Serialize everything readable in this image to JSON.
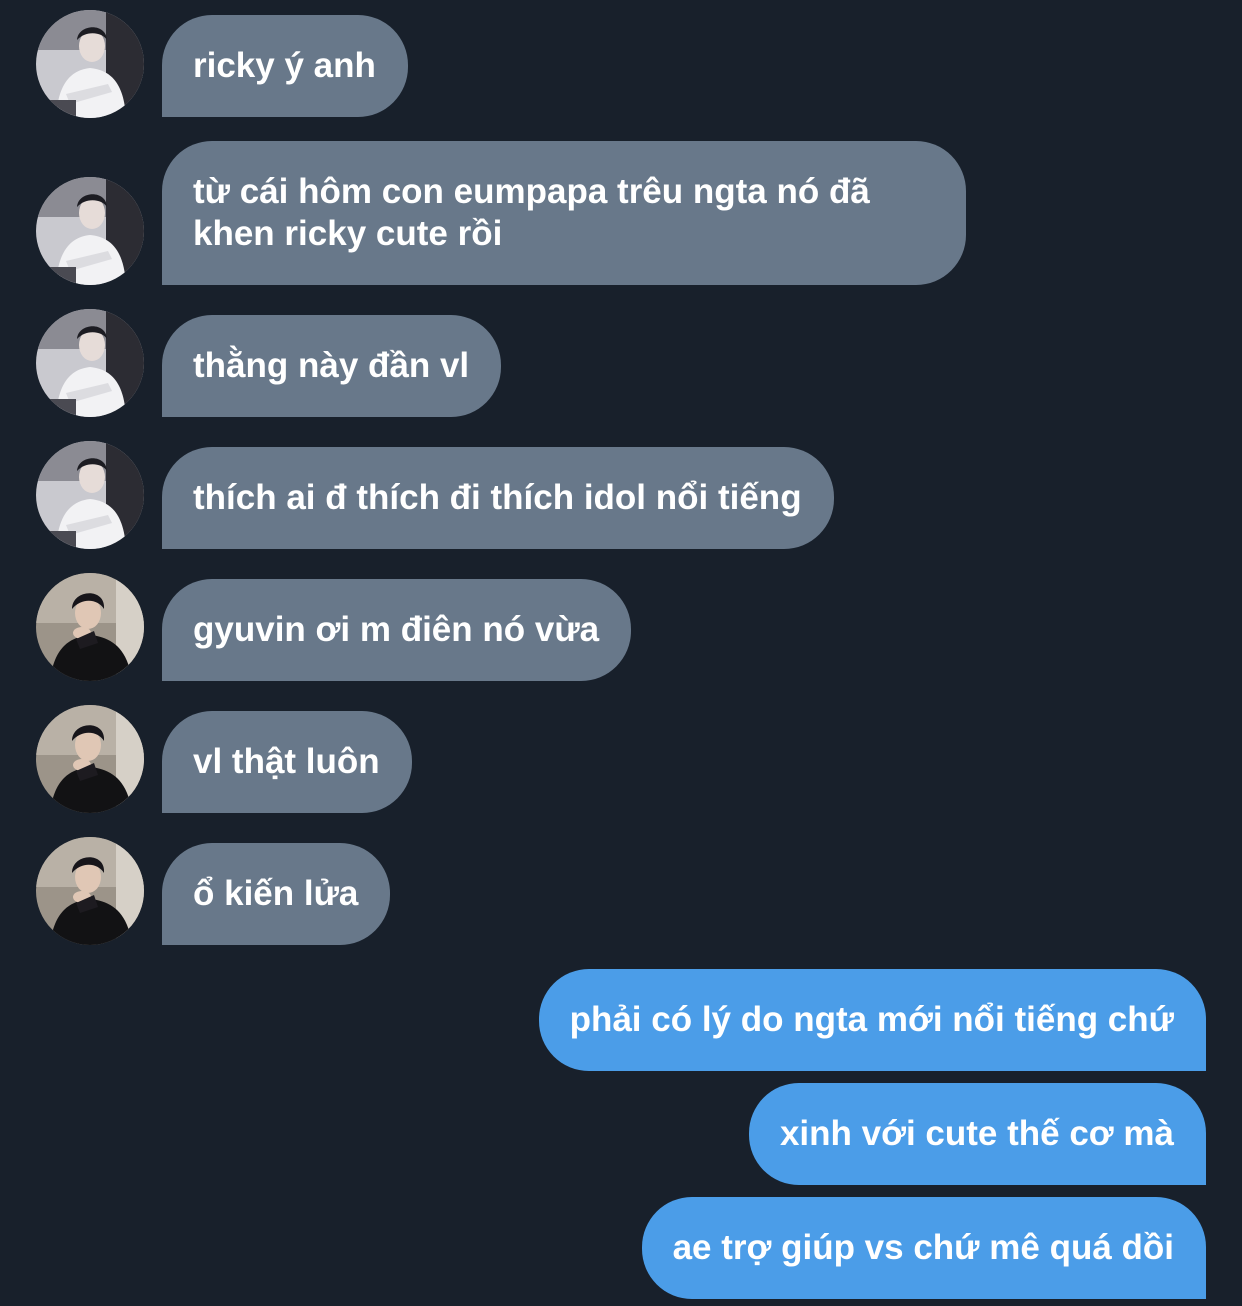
{
  "messages": [
    {
      "sender": "ricky",
      "text": "ricky ý anh"
    },
    {
      "sender": "ricky",
      "text": "từ cái hôm con eumpapa trêu ngta nó đã\nkhen ricky cute rồi"
    },
    {
      "sender": "ricky",
      "text": "thằng này đần vl"
    },
    {
      "sender": "ricky",
      "text": "thích ai đ thích đi thích idol nổi tiếng"
    },
    {
      "sender": "gyuvin",
      "text": "gyuvin ơi m điên nó vừa"
    },
    {
      "sender": "gyuvin",
      "text": "vl thật luôn"
    },
    {
      "sender": "gyuvin",
      "text": "ổ kiến lửa"
    },
    {
      "sender": "me",
      "text": "phải có lý do ngta mới nổi tiếng chứ"
    },
    {
      "sender": "me",
      "text": "xinh với cute thế cơ mà"
    },
    {
      "sender": "me",
      "text": "ae trợ giúp vs chứ mê quá dồi"
    }
  ],
  "colors": {
    "background": "#18202b",
    "incoming_bubble": "#68788a",
    "outgoing_bubble": "#4b9de8",
    "text": "#ffffff"
  }
}
